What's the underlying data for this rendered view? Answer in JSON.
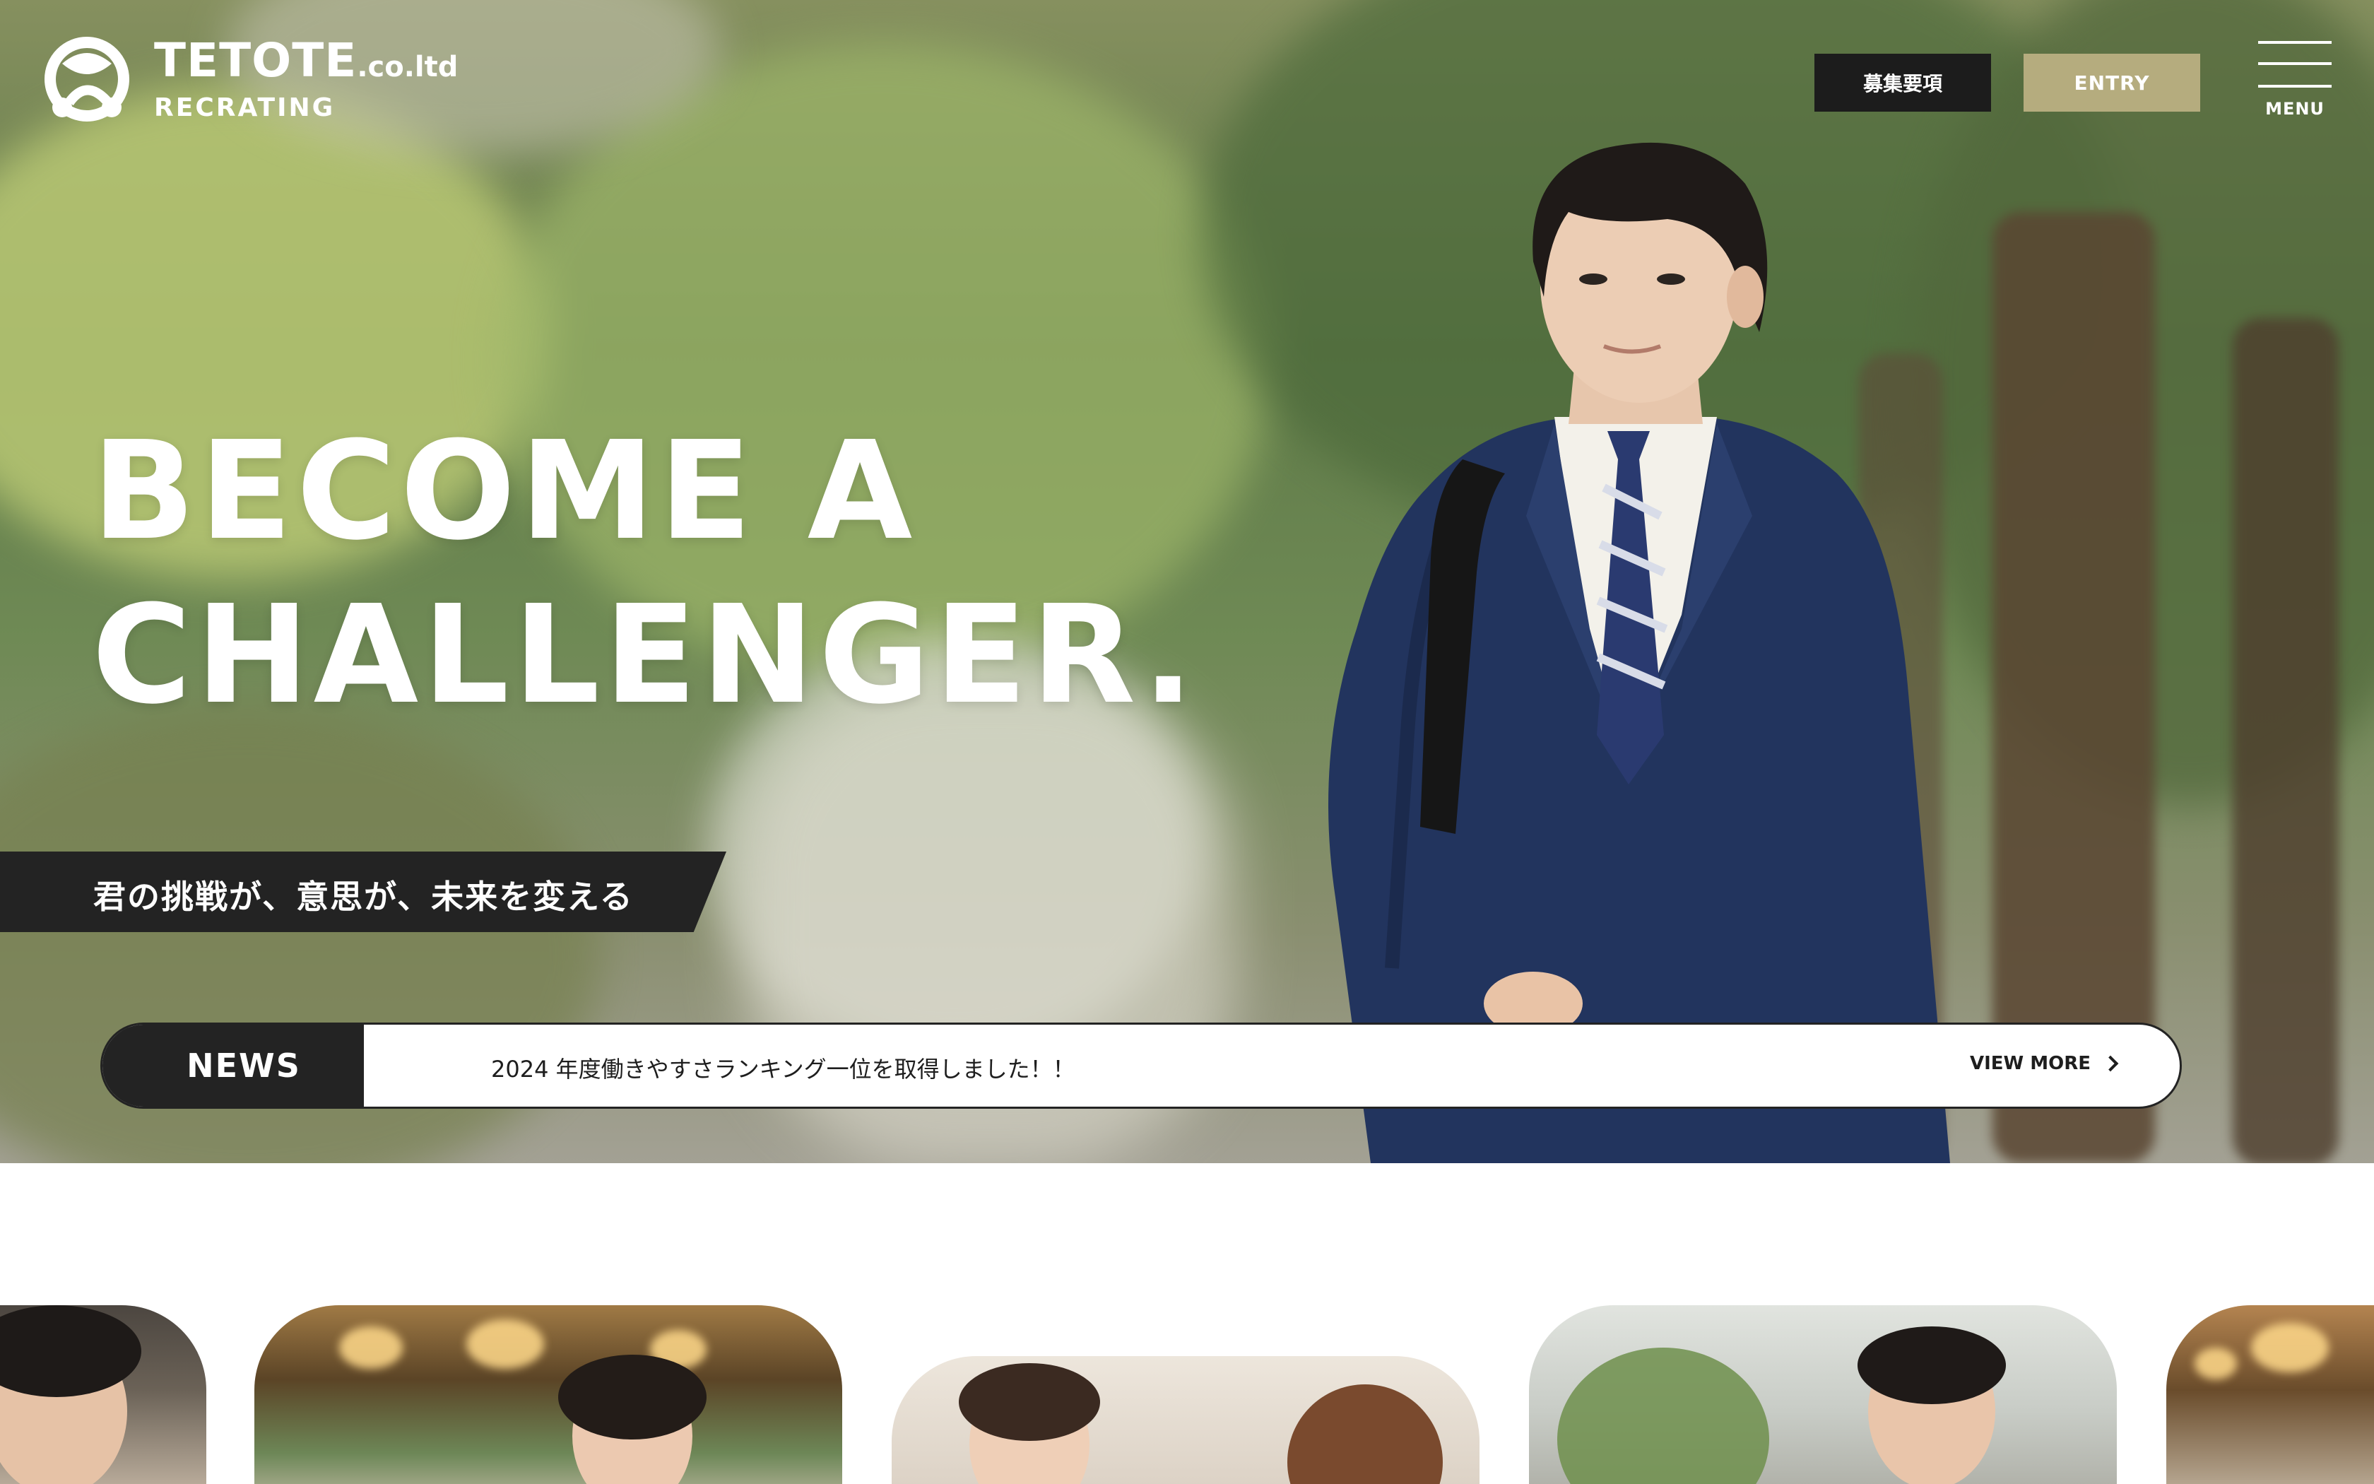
{
  "header": {
    "brand": "TETOTE",
    "brand_suffix": ".co.ltd",
    "sub_brand": "RECRATING",
    "recruit_button": "募集要項",
    "entry_button": "ENTRY",
    "menu_label": "MENU"
  },
  "hero": {
    "headline_line1": "BECOME A",
    "headline_line2": "CHALLENGER.",
    "tagline": "君の挑戦が、意思が、未来を変える"
  },
  "news": {
    "label": "NEWS",
    "headline": "2024 年度働きやすさランキング一位を取得しました！！",
    "more": "VIEW MORE"
  },
  "icons": {
    "logo": "tetote-logo-icon",
    "more_arrow": "chevron-right-icon",
    "menu": "hamburger-menu-icon"
  },
  "colors": {
    "dark": "#232323",
    "entry_accent": "#b5ac7e",
    "white": "#ffffff"
  }
}
